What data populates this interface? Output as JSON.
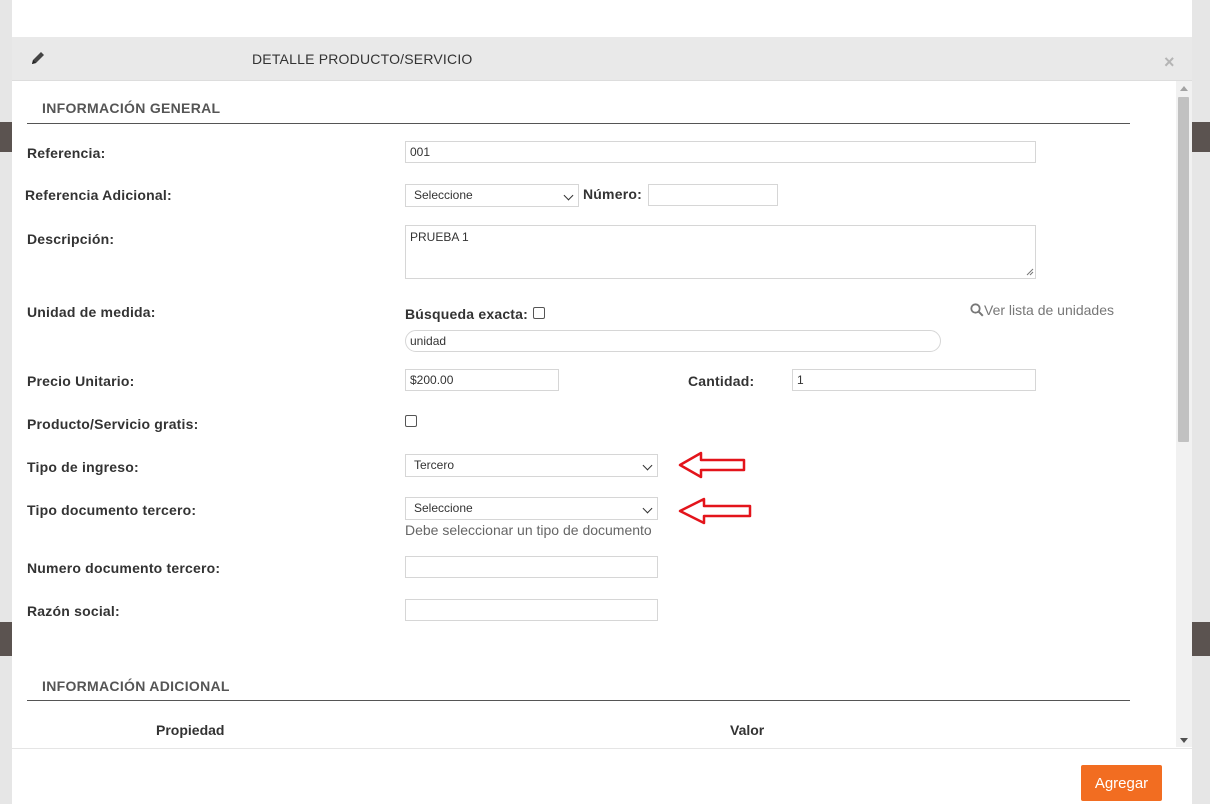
{
  "modal": {
    "title": "DETALLE PRODUCTO/SERVICIO",
    "close": "×"
  },
  "general": {
    "section_title": "INFORMACIÓN GENERAL",
    "referencia": {
      "label": "Referencia:",
      "value": "001"
    },
    "referencia_adicional": {
      "label": "Referencia Adicional:",
      "select": "Seleccione",
      "numero_label": "Número:",
      "numero_value": ""
    },
    "descripcion": {
      "label": "Descripción:",
      "value": "PRUEBA 1"
    },
    "unidad": {
      "label": "Unidad de medida:",
      "busqueda_label": "Búsqueda exacta:",
      "value": "unidad",
      "ver_lista": "Ver lista de unidades"
    },
    "precio": {
      "label": "Precio Unitario:",
      "value": "$200.00"
    },
    "cantidad": {
      "label": "Cantidad:",
      "value": "1"
    },
    "gratis": {
      "label": "Producto/Servicio gratis:"
    },
    "tipo_ingreso": {
      "label": "Tipo de ingreso:",
      "value": "Tercero"
    },
    "tipo_documento": {
      "label": "Tipo documento tercero:",
      "value": "Seleccione",
      "hint": "Debe seleccionar un tipo de documento"
    },
    "numero_documento": {
      "label": "Numero documento tercero:",
      "value": ""
    },
    "razon_social": {
      "label": "Razón social:",
      "value": ""
    }
  },
  "adicional": {
    "section_title": "INFORMACIÓN ADICIONAL",
    "columns": [
      "Propiedad",
      "Valor"
    ]
  },
  "footer": {
    "agregar": "Agregar"
  },
  "colors": {
    "accent": "#f26d21",
    "annotation_arrow": "#e3141b",
    "header_bg": "#e9e9e9"
  }
}
